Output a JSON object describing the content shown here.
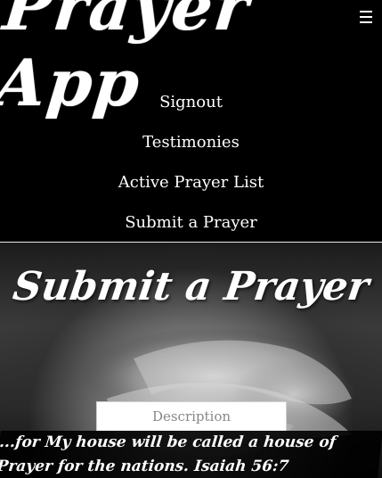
{
  "header": {
    "brand": "Prayer App",
    "menu_icon": "hamburger-menu-icon"
  },
  "nav": {
    "items": [
      {
        "label": "Signout"
      },
      {
        "label": "Testimonies"
      },
      {
        "label": "Active Prayer List"
      },
      {
        "label": "Submit a Prayer"
      }
    ]
  },
  "hero": {
    "title": "Submit a Prayer",
    "description_placeholder": "Description"
  },
  "verse": {
    "text": "...for My house will be called a house of Prayer for the nations. Isaiah 56:7"
  }
}
